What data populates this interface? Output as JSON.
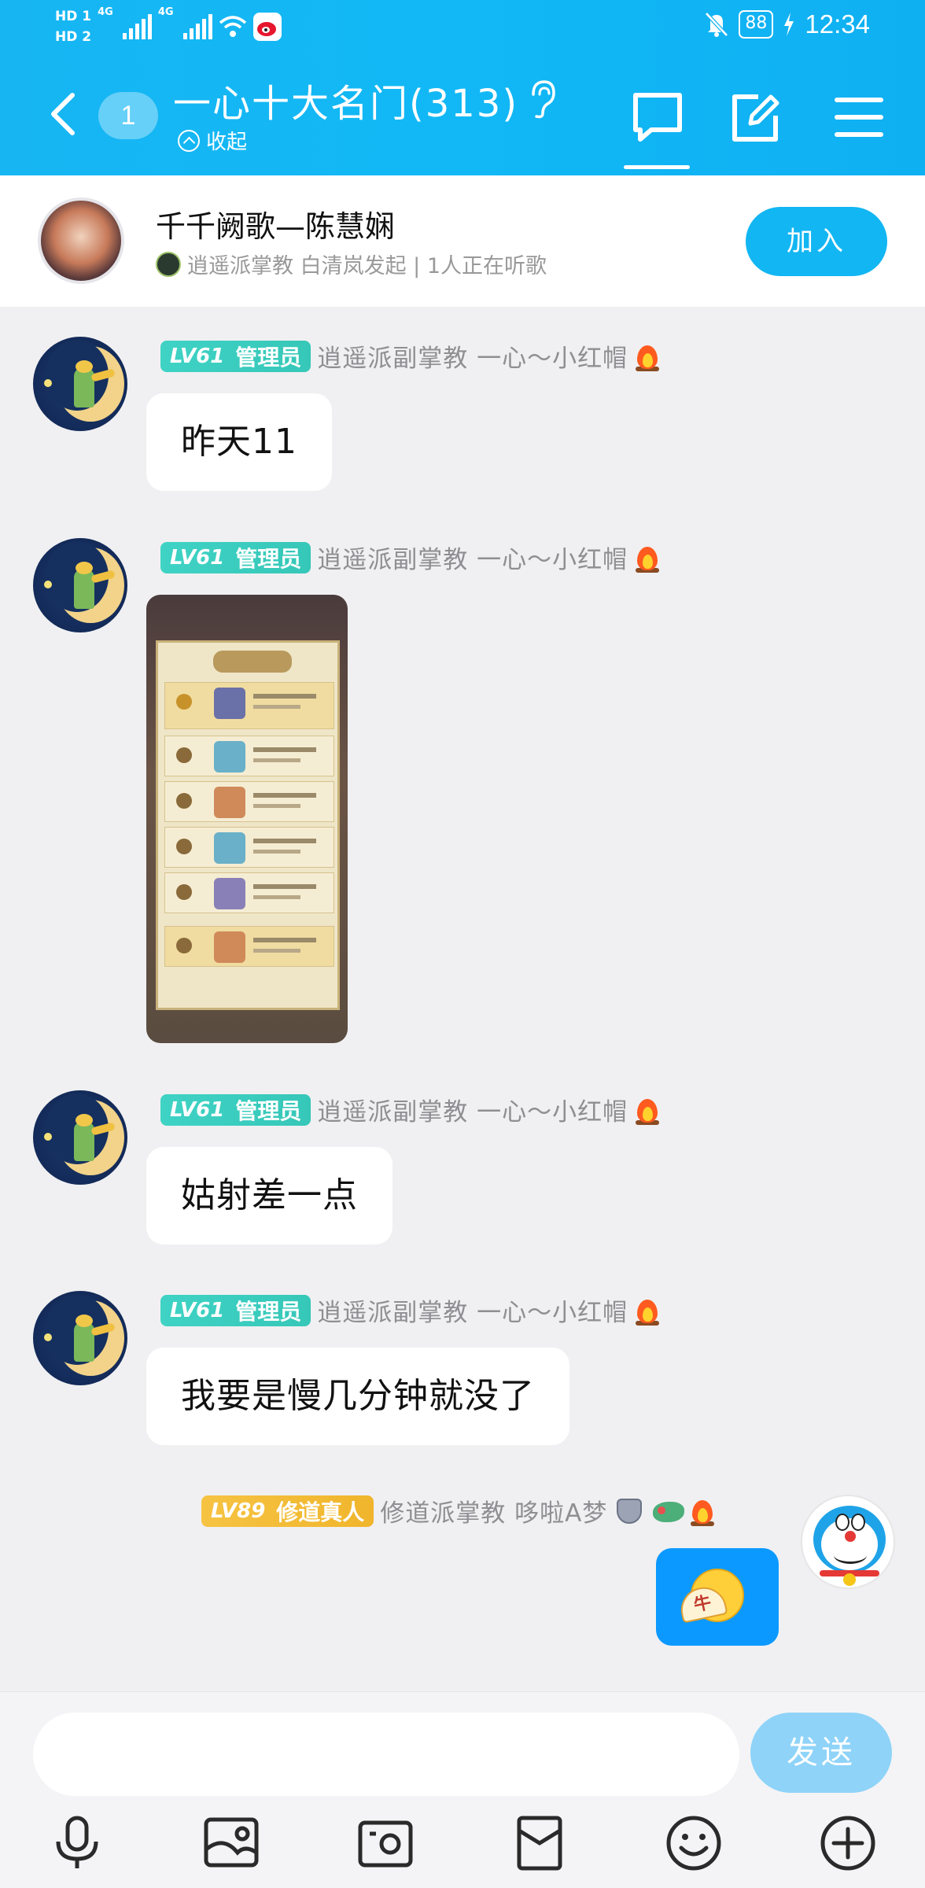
{
  "status_bar": {
    "hd1": "HD 1",
    "hd2": "HD 2",
    "net1": "4G",
    "net2": "4G",
    "battery": "88",
    "time": "12:34"
  },
  "header": {
    "unread_count": "1",
    "title": "一心十大名门(313)",
    "collapse_label": "收起"
  },
  "music_bar": {
    "song_title": "千千阙歌—陈慧娴",
    "subtitle": "逍遥派掌教 白清岚发起 | 1人正在听歌",
    "join_label": "加入"
  },
  "messages": [
    {
      "level": "LV61",
      "role": "管理员",
      "sender": "逍遥派副掌教 一心～小红帽",
      "text": "昨天11"
    },
    {
      "level": "LV61",
      "role": "管理员",
      "sender": "逍遥派副掌教 一心～小红帽",
      "image": "game-leaderboard-screenshot"
    },
    {
      "level": "LV61",
      "role": "管理员",
      "sender": "逍遥派副掌教 一心～小红帽",
      "text": "姑射差一点"
    },
    {
      "level": "LV61",
      "role": "管理员",
      "sender": "逍遥派副掌教 一心～小红帽",
      "text": "我要是慢几分钟就没了"
    },
    {
      "level": "LV89",
      "role": "修道真人",
      "sender": "修道派掌教 哆啦A梦",
      "sticker": "cow-fan-emoji"
    }
  ],
  "input": {
    "value": "",
    "send_label": "发送"
  },
  "toolbar": {
    "icons": [
      "microphone-icon",
      "image-icon",
      "camera-icon",
      "red-packet-icon",
      "emoji-icon",
      "plus-icon"
    ]
  },
  "colors": {
    "header_bg": "#12b6f2",
    "join_button": "#12b6f2",
    "self_bubble": "#0b99ff",
    "send_button_disabled": "#8fd3f8",
    "admin_badge": "#3fd3c5",
    "master_badge": "#f6c343"
  }
}
